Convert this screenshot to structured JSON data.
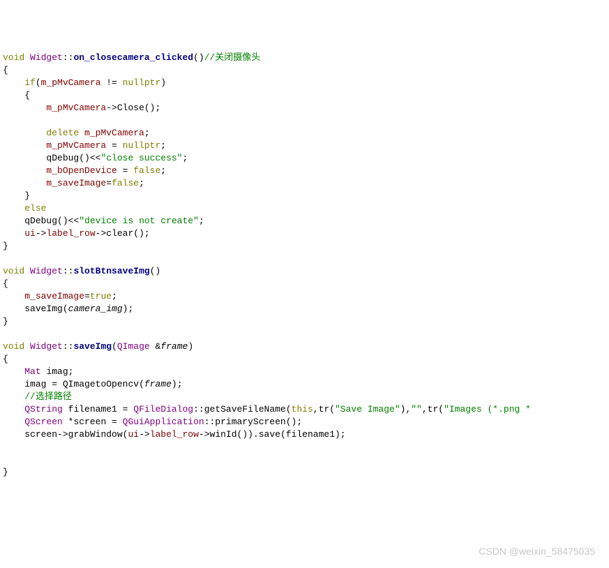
{
  "code": {
    "fn1_sig_void": "void",
    "fn1_sig_cls": "Widget",
    "fn1_sig_scope": "::",
    "fn1_sig_name": "on_closecamera_clicked",
    "fn1_sig_paren": "()",
    "fn1_cmt": "//关闭摄像头",
    "line2": "{",
    "line3_if": "    if",
    "line3_rest": "(",
    "line3_var": "m_pMvCamera",
    "line3_neq": " != ",
    "line3_null": "nullptr",
    "line3_close": ")",
    "line4": "    {",
    "line5_indent": "        ",
    "line5_var": "m_pMvCamera",
    "line5_arrow": "->",
    "line5_close": "Close",
    "line5_end": "();",
    "blank1": "",
    "line7_indent": "        ",
    "line7_del": "delete",
    "line7_sp": " ",
    "line7_var": "m_pMvCamera",
    "line7_semi": ";",
    "line8_indent": "        ",
    "line8_var": "m_pMvCamera",
    "line8_eq": " = ",
    "line8_null": "nullptr",
    "line8_semi": ";",
    "line9_indent": "        ",
    "line9_qd": "qDebug",
    "line9_mid": "()<<",
    "line9_str": "\"close success\"",
    "line9_semi": ";",
    "line10_indent": "        ",
    "line10_var": "m_bOpenDevice",
    "line10_eq": " = ",
    "line10_false": "false",
    "line10_semi": ";",
    "line11_indent": "        ",
    "line11_var": "m_saveImage",
    "line11_eq": "=",
    "line11_false": "false",
    "line11_semi": ";",
    "line12": "    }",
    "line13_indent": "    ",
    "line13_else": "else",
    "line14_indent": "    ",
    "line14_qd": "qDebug",
    "line14_mid": "()<<",
    "line14_str": "\"device is not create\"",
    "line14_semi": ";",
    "line15_indent": "    ",
    "line15_var": "ui",
    "line15_arrow": "->",
    "line15_label": "label_row",
    "line15_arrow2": "->",
    "line15_clear": "clear",
    "line15_end": "();",
    "line16": "}",
    "blank2": "",
    "fn2_sig_void": "void",
    "fn2_sig_cls": "Widget",
    "fn2_sig_scope": "::",
    "fn2_sig_name": "slotBtnsaveImg",
    "fn2_sig_paren": "()",
    "line19": "{",
    "line20_indent": "    ",
    "line20_var": "m_saveImage",
    "line20_eq": "=",
    "line20_true": "true",
    "line20_semi": ";",
    "line21_indent": "    ",
    "line21_save": "saveImg",
    "line21_open": "(",
    "line21_param": "camera_img",
    "line21_close": ");",
    "line22": "}",
    "blank3": "",
    "fn3_sig_void": "void",
    "fn3_sig_cls": "Widget",
    "fn3_sig_scope": "::",
    "fn3_sig_name": "saveImg",
    "fn3_sig_open": "(",
    "fn3_sig_type": "QImage",
    "fn3_sig_amp": " &",
    "fn3_sig_param": "frame",
    "fn3_sig_close": ")",
    "line25": "{",
    "line26_indent": "    ",
    "line26_mat": "Mat",
    "line26_sp": " ",
    "line26_imag": "imag",
    "line26_semi": ";",
    "line27_indent": "    ",
    "line27_imag": "imag",
    "line27_eq": " = ",
    "line27_conv": "QImagetoOpencv",
    "line27_open": "(",
    "line27_param": "frame",
    "line27_close": ");",
    "line28_indent": "    ",
    "line28_cmt": "//选择路径",
    "line29_indent": "    ",
    "line29_qs": "QString",
    "line29_sp": " ",
    "line29_fn1": "filename1",
    "line29_eq": " = ",
    "line29_qfd": "QFileDialog",
    "line29_scope": "::",
    "line29_gsfn": "getSaveFileName",
    "line29_open": "(",
    "line29_this": "this",
    "line29_c1": ",",
    "line29_tr1": "tr",
    "line29_p1": "(",
    "line29_s1": "\"Save Image\"",
    "line29_p1c": "),",
    "line29_s2": "\"\"",
    "line29_c2": ",",
    "line29_tr2": "tr",
    "line29_p2": "(",
    "line29_s3": "\"Images (*.png *",
    "line30_indent": "    ",
    "line30_qsc": "QScreen",
    "line30_star": " *",
    "line30_scr": "screen",
    "line30_eq": " = ",
    "line30_qga": "QGuiApplication",
    "line30_scope": "::",
    "line30_ps": "primaryScreen",
    "line30_end": "();",
    "line31_indent": "    ",
    "line31_scr": "screen",
    "line31_arrow": "->",
    "line31_gw": "grabWindow",
    "line31_open": "(",
    "line31_ui": "ui",
    "line31_arrow2": "->",
    "line31_lr": "label_row",
    "line31_arrow3": "->",
    "line31_wid": "winId",
    "line31_mid": "()).",
    "line31_save": "save",
    "line31_open2": "(",
    "line31_fn1": "filename1",
    "line31_close": ");",
    "blank4": "",
    "blank5": "",
    "line34": "}"
  },
  "watermark": "CSDN @weixin_58475035"
}
